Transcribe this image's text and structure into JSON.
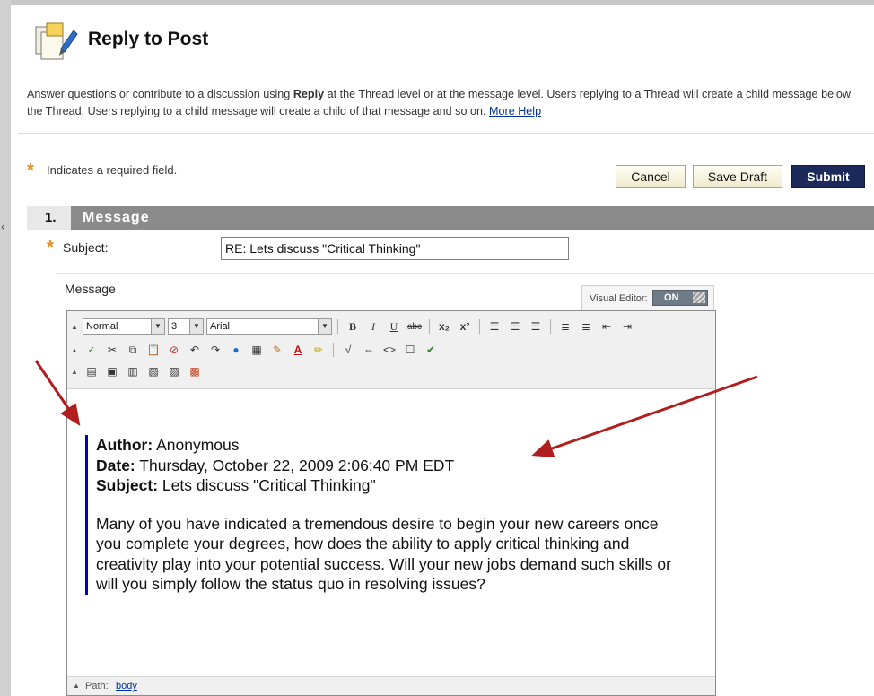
{
  "page": {
    "title": "Reply to Post",
    "instructions_prefix": "Answer questions or contribute to a discussion using ",
    "instructions_bold": "Reply",
    "instructions_suffix": " at the Thread level or at the message level. Users replying to a Thread will create a child message below the Thread. Users replying to a child message will create a child of that message and so on. ",
    "more_help": "More Help"
  },
  "form": {
    "required_note": "Indicates a required field.",
    "buttons": {
      "cancel": "Cancel",
      "save_draft": "Save Draft",
      "submit": "Submit"
    },
    "section": {
      "number": "1.",
      "title": "Message"
    },
    "subject_label": "Subject:",
    "subject_value": "RE: Lets discuss \"Critical Thinking\"",
    "message_label": "Message",
    "visual_editor": {
      "label": "Visual Editor:",
      "state": "ON"
    }
  },
  "editor": {
    "toolbar": {
      "format_select": "Normal",
      "size_select": "3",
      "font_select": "Arial"
    },
    "content": {
      "author_label": "Author:",
      "author_value": " Anonymous",
      "date_label": "Date:",
      "date_value": " Thursday, October 22, 2009 2:06:40 PM EDT",
      "subject_label": "Subject:",
      "subject_value": " Lets discuss \"Critical Thinking\"",
      "body": "Many of you have indicated a tremendous desire to begin your new careers once you complete your degrees, how does the ability to apply critical thinking and creativity play into your potential success. Will your new jobs demand such skills or will you simply follow the status quo in resolving issues?"
    },
    "path": {
      "label": "Path:",
      "value": "body"
    }
  },
  "colors": {
    "accent_orange": "#e88b1c",
    "submit_bg": "#1b2a5a",
    "quote_border": "#0000cc",
    "annotation_arrow": "#b01e1e"
  }
}
